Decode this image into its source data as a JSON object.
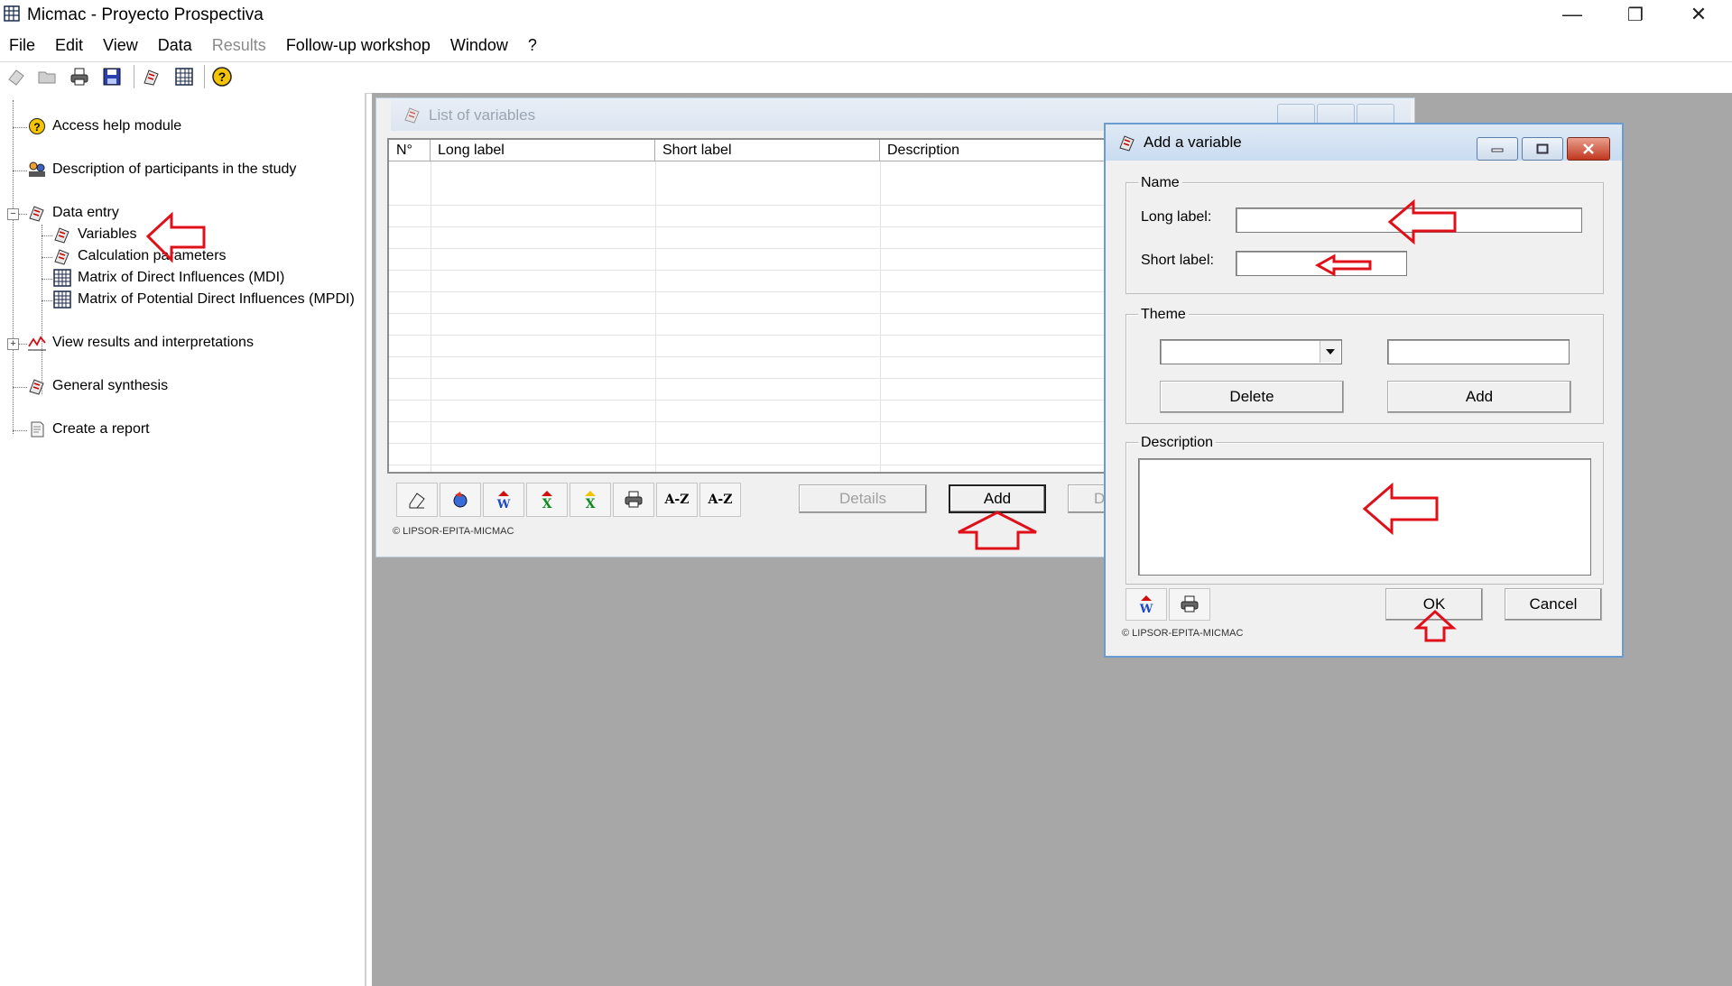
{
  "app": {
    "title": "Micmac  -  Proyecto Prospectiva",
    "minimize": "—",
    "maximize": "❐",
    "close": "✕"
  },
  "menu": {
    "items": [
      {
        "label": "File",
        "enabled": true
      },
      {
        "label": "Edit",
        "enabled": true
      },
      {
        "label": "View",
        "enabled": true
      },
      {
        "label": "Data",
        "enabled": true
      },
      {
        "label": "Results",
        "enabled": false
      },
      {
        "label": "Follow-up workshop",
        "enabled": true
      },
      {
        "label": "Window",
        "enabled": true
      },
      {
        "label": "?",
        "enabled": true
      }
    ]
  },
  "toolbar": {
    "icons": [
      "new-icon",
      "open-icon",
      "print-icon",
      "save-icon",
      "variables-icon",
      "matrix-icon",
      "help-icon"
    ]
  },
  "tree": {
    "items": [
      {
        "label": "Access help module",
        "icon": "help-icon"
      },
      {
        "label": "Description of participants in the study",
        "icon": "participants-icon"
      },
      {
        "label": "Data entry",
        "icon": "data-entry-icon",
        "expander": "−"
      },
      {
        "label": "Variables",
        "icon": "variables-icon"
      },
      {
        "label": "Calculation parameters",
        "icon": "parameters-icon"
      },
      {
        "label": "Matrix of Direct Influences (MDI)",
        "icon": "matrix-icon"
      },
      {
        "label": "Matrix of Potential Direct Influences (MPDI)",
        "icon": "matrix-icon"
      },
      {
        "label": "View results and interpretations",
        "icon": "chart-icon",
        "expander": "+"
      },
      {
        "label": "General synthesis",
        "icon": "synthesis-icon"
      },
      {
        "label": "Create a report",
        "icon": "report-icon"
      }
    ]
  },
  "list_window": {
    "title": "List of variables",
    "columns": [
      "N°",
      "Long label",
      "Short label",
      "Description"
    ],
    "rows": [],
    "toolbar_buttons": [
      "eraser-icon",
      "refresh-icon",
      "word-export-icon",
      "excel-export-icon",
      "excel-import-icon",
      "print-icon",
      "A-Z",
      "A-Z"
    ],
    "details_label": "Details",
    "add_label": "Add",
    "delete_label": "D",
    "copyright": "© LIPSOR-EPITA-MICMAC"
  },
  "dialog": {
    "title": "Add a variable",
    "name_group": "Name",
    "long_label": "Long label:",
    "long_value": "",
    "short_label": "Short label:",
    "short_value": "",
    "theme_group": "Theme",
    "theme_selected": "",
    "theme_new": "",
    "delete_label": "Delete",
    "add_label": "Add",
    "description_group": "Description",
    "description_value": "",
    "ok_label": "OK",
    "cancel_label": "Cancel",
    "copyright": "© LIPSOR-EPITA-MICMAC"
  },
  "colors": {
    "mdi_background": "#a7a7a7",
    "annotation_arrow": "#e0101a",
    "dialog_border": "#6a9bd1"
  }
}
